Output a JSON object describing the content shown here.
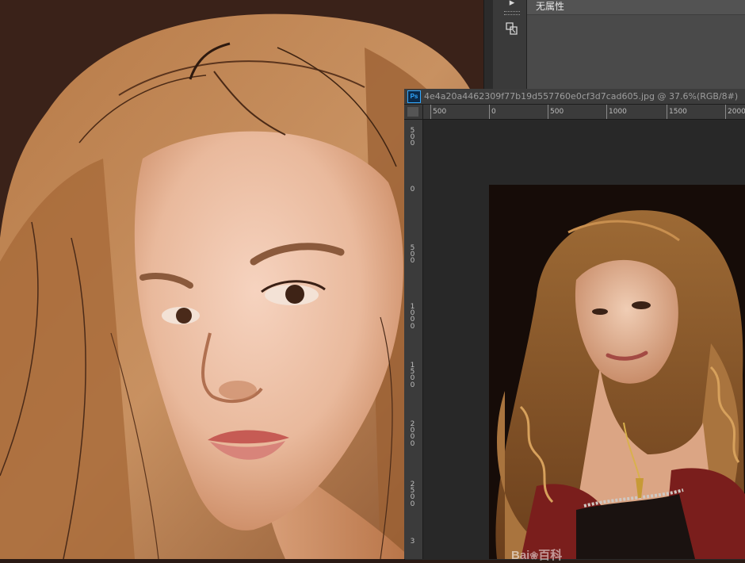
{
  "properties_panel": {
    "label": "无属性"
  },
  "document": {
    "app_badge": "Ps",
    "title": "4e4a20a4462309f77b19d557760e0cf3d7cad605.jpg @ 37.6%(RGB/8#)"
  },
  "h_ruler": {
    "labels": [
      "500",
      "0",
      "500",
      "1000",
      "1500",
      "2000"
    ]
  },
  "v_ruler": {
    "labels": [
      "500",
      "0",
      "500",
      "1000",
      "1500",
      "2000",
      "2500",
      "3"
    ]
  },
  "watermark": {
    "brand": "Bai",
    "brand_suffix": "百科"
  },
  "colors": {
    "panel_bg": "#4a4a4a",
    "ruler_bg": "#3b3b3b",
    "canvas_bg": "#282828",
    "ps_blue": "#31a8ff"
  }
}
